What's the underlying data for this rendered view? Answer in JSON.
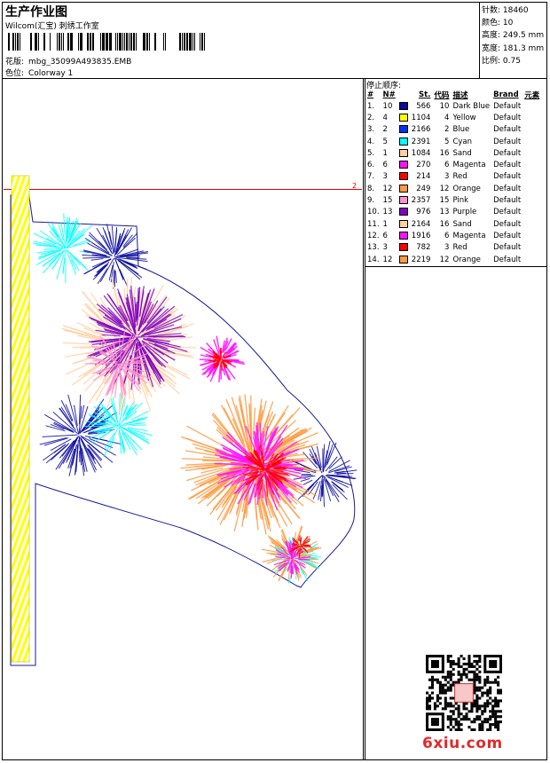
{
  "header": {
    "title": "生产作业图",
    "subtitle": "Wilcom(汇宝) 刺绣工作室",
    "design_label": "花版:",
    "design_value": "mbg_35099A493835.EMB",
    "colorway_label": "色位:",
    "colorway_value": "Colorway 1"
  },
  "stats": {
    "stitches_label": "针数:",
    "stitches": "18460",
    "colors_label": "颜色:",
    "colors": "10",
    "height_label": "高度:",
    "height": "249.5 mm",
    "width_label": "宽度:",
    "width": "181.3 mm",
    "scale_label": "比例:",
    "scale": "0.75"
  },
  "stop_sequence": {
    "title": "停止顺序:",
    "headers": [
      "#",
      "N#",
      "St.",
      "代码",
      "描述",
      "Brand",
      "元素"
    ],
    "rows": [
      {
        "n": "1.",
        "nn": "10",
        "color": "#0a0aa0",
        "st": "566",
        "code": "10",
        "desc": "Dark Blue",
        "brand": "Default"
      },
      {
        "n": "2.",
        "nn": "4",
        "color": "#ffff00",
        "st": "1104",
        "code": "4",
        "desc": "Yellow",
        "brand": "Default"
      },
      {
        "n": "3.",
        "nn": "2",
        "color": "#0030ff",
        "st": "2166",
        "code": "2",
        "desc": "Blue",
        "brand": "Default"
      },
      {
        "n": "4.",
        "nn": "5",
        "color": "#00ffff",
        "st": "2391",
        "code": "5",
        "desc": "Cyan",
        "brand": "Default"
      },
      {
        "n": "5.",
        "nn": "1",
        "color": "#ffd0a0",
        "st": "1084",
        "code": "16",
        "desc": "Sand",
        "brand": "Default"
      },
      {
        "n": "6.",
        "nn": "6",
        "color": "#ff10ff",
        "st": "270",
        "code": "6",
        "desc": "Magenta",
        "brand": "Default"
      },
      {
        "n": "7.",
        "nn": "3",
        "color": "#ff0000",
        "st": "214",
        "code": "3",
        "desc": "Red",
        "brand": "Default"
      },
      {
        "n": "8.",
        "nn": "12",
        "color": "#ff9a40",
        "st": "249",
        "code": "12",
        "desc": "Orange",
        "brand": "Default"
      },
      {
        "n": "9.",
        "nn": "15",
        "color": "#ff90d0",
        "st": "2357",
        "code": "15",
        "desc": "Pink",
        "brand": "Default"
      },
      {
        "n": "10.",
        "nn": "13",
        "color": "#8000c0",
        "st": "976",
        "code": "13",
        "desc": "Purple",
        "brand": "Default"
      },
      {
        "n": "11.",
        "nn": "1",
        "color": "#ffd0a0",
        "st": "2164",
        "code": "16",
        "desc": "Sand",
        "brand": "Default"
      },
      {
        "n": "12.",
        "nn": "6",
        "color": "#ff10ff",
        "st": "1916",
        "code": "6",
        "desc": "Magenta",
        "brand": "Default"
      },
      {
        "n": "13.",
        "nn": "3",
        "color": "#ff0000",
        "st": "782",
        "code": "3",
        "desc": "Red",
        "brand": "Default"
      },
      {
        "n": "14.",
        "nn": "12",
        "color": "#ff9a40",
        "st": "2219",
        "code": "12",
        "desc": "Orange",
        "brand": "Default"
      }
    ]
  },
  "canvas": {
    "guide_label": "2"
  },
  "watermark": "6xiu.com",
  "icons": {
    "qr": "qr-code-icon",
    "stamp": "seal-stamp-icon"
  }
}
